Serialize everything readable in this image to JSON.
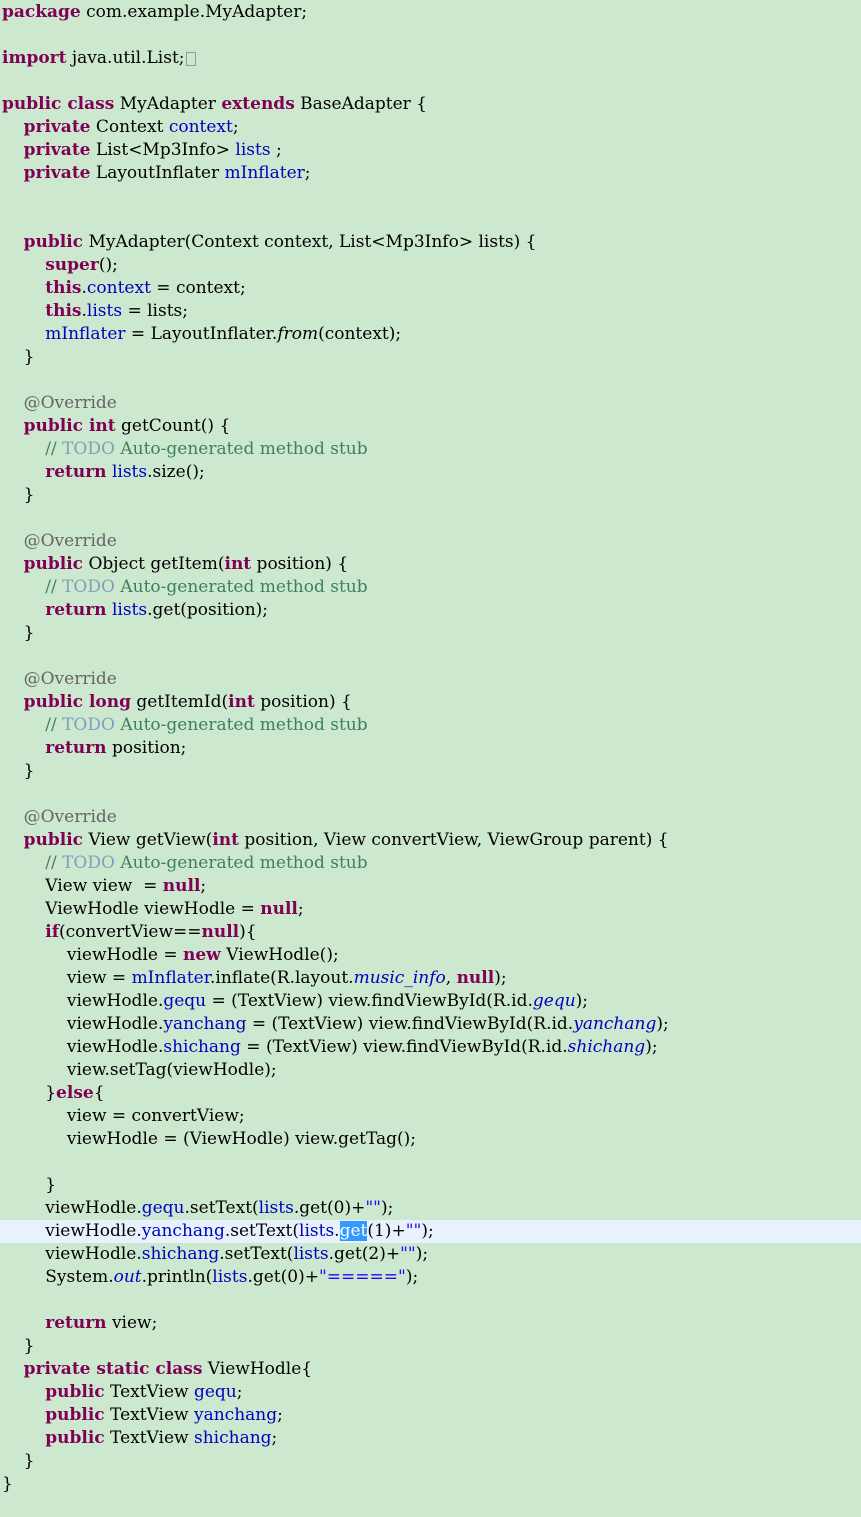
{
  "editor": {
    "language": "java",
    "current_line": 54,
    "selected_text": "get",
    "colors": {
      "background": "#cce8cf",
      "keyword": "#7f0055",
      "field": "#0000c0",
      "annotation": "#646464",
      "comment": "#3f7f5f",
      "todo": "#7f9fbf",
      "string": "#2a00ff",
      "current_line": "#e8f2fe",
      "selection": "#3399ff"
    },
    "lines": [
      [
        [
          "kw",
          "package"
        ],
        [
          "",
          "com.example.MyAdapter;"
        ]
      ],
      [],
      [
        [
          "kw",
          "import"
        ],
        [
          "",
          "java.util.List;"
        ],
        [
          "fold",
          ""
        ]
      ],
      [],
      [
        [
          "kw",
          "public class"
        ],
        [
          "",
          "MyAdapter "
        ],
        [
          "kw",
          "extends"
        ],
        [
          "",
          " BaseAdapter {"
        ]
      ],
      [
        [
          "",
          "    "
        ],
        [
          "kw",
          "private"
        ],
        [
          "",
          "Context "
        ],
        [
          "field",
          "context"
        ],
        [
          "",
          ";"
        ]
      ],
      [
        [
          "",
          "    "
        ],
        [
          "kw",
          "private"
        ],
        [
          "",
          "List<Mp3Info> "
        ],
        [
          "field",
          "lists"
        ],
        [
          "",
          " ;"
        ]
      ],
      [
        [
          "",
          "    "
        ],
        [
          "kw",
          "private"
        ],
        [
          "",
          "LayoutInflater "
        ],
        [
          "field",
          "mInflater"
        ],
        [
          "",
          ";"
        ]
      ],
      [],
      [],
      [
        [
          "",
          "    "
        ],
        [
          "kw",
          "public"
        ],
        [
          "",
          "MyAdapter(Context context, List<Mp3Info> lists) {"
        ]
      ],
      [
        [
          "",
          "        "
        ],
        [
          "kw",
          "super"
        ],
        [
          "",
          "();"
        ]
      ],
      [
        [
          "",
          "        "
        ],
        [
          "kw",
          "this"
        ],
        [
          "",
          "."
        ],
        [
          "field",
          "context"
        ],
        [
          "",
          " = context;"
        ]
      ],
      [
        [
          "",
          "        "
        ],
        [
          "kw",
          "this"
        ],
        [
          "",
          "."
        ],
        [
          "field",
          "lists"
        ],
        [
          "",
          " = lists;"
        ]
      ],
      [
        [
          "",
          "        "
        ],
        [
          "field",
          "mInflater"
        ],
        [
          "",
          " = LayoutInflater."
        ],
        [
          "italic",
          "from"
        ],
        [
          "",
          "(context);"
        ]
      ],
      [
        [
          "",
          "    }"
        ]
      ],
      [],
      [
        [
          "",
          "    "
        ],
        [
          "ann",
          "@Override"
        ]
      ],
      [
        [
          "",
          "    "
        ],
        [
          "kw",
          "public int"
        ],
        [
          "",
          "getCount() {"
        ]
      ],
      [
        [
          "",
          "        "
        ],
        [
          "cmt",
          "// "
        ],
        [
          "todo",
          "TODO"
        ],
        [
          "cmt",
          " Auto-generated method stub"
        ]
      ],
      [
        [
          "",
          "        "
        ],
        [
          "kw",
          "return"
        ],
        [
          "field",
          "lists"
        ],
        [
          "",
          ".size();"
        ]
      ],
      [
        [
          "",
          "    }"
        ]
      ],
      [],
      [
        [
          "",
          "    "
        ],
        [
          "ann",
          "@Override"
        ]
      ],
      [
        [
          "",
          "    "
        ],
        [
          "kw",
          "public"
        ],
        [
          "",
          "Object getItem("
        ],
        [
          "kw",
          "int"
        ],
        [
          "",
          " position) {"
        ]
      ],
      [
        [
          "",
          "        "
        ],
        [
          "cmt",
          "// "
        ],
        [
          "todo",
          "TODO"
        ],
        [
          "cmt",
          " Auto-generated method stub"
        ]
      ],
      [
        [
          "",
          "        "
        ],
        [
          "kw",
          "return"
        ],
        [
          "field",
          "lists"
        ],
        [
          "",
          ".get(position);"
        ]
      ],
      [
        [
          "",
          "    }"
        ]
      ],
      [],
      [
        [
          "",
          "    "
        ],
        [
          "ann",
          "@Override"
        ]
      ],
      [
        [
          "",
          "    "
        ],
        [
          "kw",
          "public long"
        ],
        [
          "",
          "getItemId("
        ],
        [
          "kw",
          "int"
        ],
        [
          "",
          " position) {"
        ]
      ],
      [
        [
          "",
          "        "
        ],
        [
          "cmt",
          "// "
        ],
        [
          "todo",
          "TODO"
        ],
        [
          "cmt",
          " Auto-generated method stub"
        ]
      ],
      [
        [
          "",
          "        "
        ],
        [
          "kw",
          "return"
        ],
        [
          "",
          "position;"
        ]
      ],
      [
        [
          "",
          "    }"
        ]
      ],
      [],
      [
        [
          "",
          "    "
        ],
        [
          "ann",
          "@Override"
        ]
      ],
      [
        [
          "",
          "    "
        ],
        [
          "kw",
          "public"
        ],
        [
          "",
          "View getView("
        ],
        [
          "kw",
          "int"
        ],
        [
          "",
          " position, View convertView, ViewGroup parent) {"
        ]
      ],
      [
        [
          "",
          "        "
        ],
        [
          "cmt",
          "// "
        ],
        [
          "todo",
          "TODO"
        ],
        [
          "cmt",
          " Auto-generated method stub"
        ]
      ],
      [
        [
          "",
          "        View view  = "
        ],
        [
          "kw",
          "null"
        ],
        [
          "",
          ";"
        ]
      ],
      [
        [
          "",
          "        ViewHodle viewHodle = "
        ],
        [
          "kw",
          "null"
        ],
        [
          "",
          ";"
        ]
      ],
      [
        [
          "",
          "        "
        ],
        [
          "kw",
          "if"
        ],
        [
          "",
          "(convertView=="
        ],
        [
          "kw",
          "null"
        ],
        [
          "",
          "){"
        ]
      ],
      [
        [
          "",
          "            viewHodle = "
        ],
        [
          "kw",
          "new"
        ],
        [
          "",
          "ViewHodle();"
        ]
      ],
      [
        [
          "",
          "            view = "
        ],
        [
          "field",
          "mInflater"
        ],
        [
          "",
          ".inflate(R.layout."
        ],
        [
          "static",
          "music_info"
        ],
        [
          "",
          ", "
        ],
        [
          "kw",
          "null"
        ],
        [
          "",
          ");"
        ]
      ],
      [
        [
          "",
          "            viewHodle."
        ],
        [
          "field",
          "gequ"
        ],
        [
          "",
          " = (TextView) view.findViewById(R.id."
        ],
        [
          "static",
          "gequ"
        ],
        [
          "",
          ");"
        ]
      ],
      [
        [
          "",
          "            viewHodle."
        ],
        [
          "field",
          "yanchang"
        ],
        [
          "",
          " = (TextView) view.findViewById(R.id."
        ],
        [
          "static",
          "yanchang"
        ],
        [
          "",
          ");"
        ]
      ],
      [
        [
          "",
          "            viewHodle."
        ],
        [
          "field",
          "shichang"
        ],
        [
          "",
          " = (TextView) view.findViewById(R.id."
        ],
        [
          "static",
          "shichang"
        ],
        [
          "",
          ");"
        ]
      ],
      [
        [
          "",
          "            view.setTag(viewHodle);"
        ]
      ],
      [
        [
          "",
          "        }"
        ],
        [
          "kw",
          "else"
        ],
        [
          "",
          "{"
        ]
      ],
      [
        [
          "",
          "            view = convertView;"
        ]
      ],
      [
        [
          "",
          "            viewHodle = (ViewHodle) view.getTag();"
        ]
      ],
      [],
      [
        [
          "",
          "        }"
        ]
      ],
      [
        [
          "",
          "        viewHodle."
        ],
        [
          "field",
          "gequ"
        ],
        [
          "",
          ".setText("
        ],
        [
          "field",
          "lists"
        ],
        [
          "",
          ".get(0)+"
        ],
        [
          "str",
          "\"\""
        ],
        [
          "",
          ");"
        ]
      ],
      [
        [
          "",
          "        viewHodle."
        ],
        [
          "field",
          "yanchang"
        ],
        [
          "",
          ".setText("
        ],
        [
          "field",
          "lists"
        ],
        [
          "",
          "."
        ],
        [
          "sel",
          "get"
        ],
        [
          "",
          "(1)+"
        ],
        [
          "str",
          "\"\""
        ],
        [
          "",
          ");"
        ]
      ],
      [
        [
          "",
          "        viewHodle."
        ],
        [
          "field",
          "shichang"
        ],
        [
          "",
          ".setText("
        ],
        [
          "field",
          "lists"
        ],
        [
          "",
          ".get(2)+"
        ],
        [
          "str",
          "\"\""
        ],
        [
          "",
          ");"
        ]
      ],
      [
        [
          "",
          "        System."
        ],
        [
          "static",
          "out"
        ],
        [
          "",
          ".println("
        ],
        [
          "field",
          "lists"
        ],
        [
          "",
          ".get(0)+"
        ],
        [
          "str",
          "\"=====\""
        ],
        [
          "",
          ");"
        ]
      ],
      [],
      [
        [
          "",
          "        "
        ],
        [
          "kw",
          "return"
        ],
        [
          "",
          "view;"
        ]
      ],
      [
        [
          "",
          "    }"
        ]
      ],
      [
        [
          "",
          "    "
        ],
        [
          "kw",
          "private static class"
        ],
        [
          "",
          "ViewHodle{"
        ]
      ],
      [
        [
          "",
          "        "
        ],
        [
          "kw",
          "public"
        ],
        [
          "",
          "TextView "
        ],
        [
          "field",
          "gequ"
        ],
        [
          "",
          ";"
        ]
      ],
      [
        [
          "",
          "        "
        ],
        [
          "kw",
          "public"
        ],
        [
          "",
          "TextView "
        ],
        [
          "field",
          "yanchang"
        ],
        [
          "",
          ";"
        ]
      ],
      [
        [
          "",
          "        "
        ],
        [
          "kw",
          "public"
        ],
        [
          "",
          "TextView "
        ],
        [
          "field",
          "shichang"
        ],
        [
          "",
          ";"
        ]
      ],
      [
        [
          "",
          "    }"
        ]
      ],
      [
        [
          "",
          "}"
        ]
      ]
    ]
  }
}
